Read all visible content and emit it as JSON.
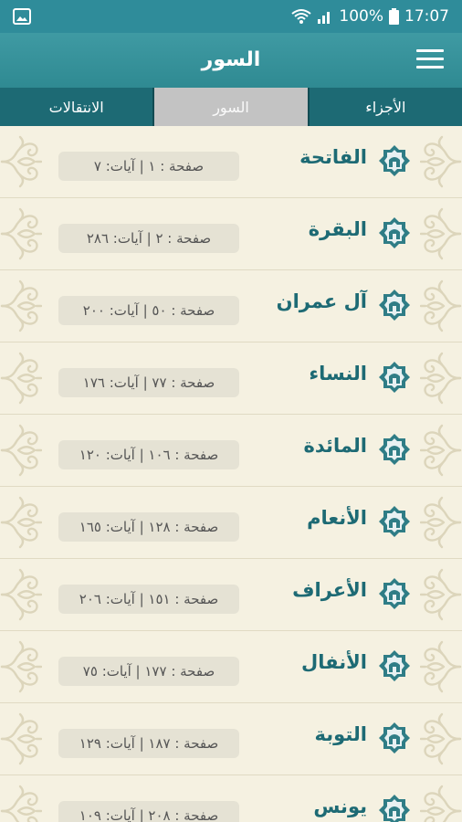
{
  "status_bar": {
    "battery": "100%",
    "time": "17:07"
  },
  "app_bar": {
    "title": "السور"
  },
  "tabs": [
    {
      "label": "الأجزاء",
      "selected": false
    },
    {
      "label": "السور",
      "selected": true
    },
    {
      "label": "الانتقالات",
      "selected": false
    }
  ],
  "suras": [
    {
      "name": "الفاتحة",
      "info": "صفحة : ١ | آيات: ٧"
    },
    {
      "name": "البقرة",
      "info": "صفحة : ٢ | آيات: ٢٨٦"
    },
    {
      "name": "آل عمران",
      "info": "صفحة : ٥٠ | آيات: ٢٠٠"
    },
    {
      "name": "النساء",
      "info": "صفحة : ٧٧ | آيات: ١٧٦"
    },
    {
      "name": "المائدة",
      "info": "صفحة : ١٠٦ | آيات: ١٢٠"
    },
    {
      "name": "الأنعام",
      "info": "صفحة : ١٢٨ | آيات: ١٦٥"
    },
    {
      "name": "الأعراف",
      "info": "صفحة : ١٥١ | آيات: ٢٠٦"
    },
    {
      "name": "الأنفال",
      "info": "صفحة : ١٧٧ | آيات: ٧٥"
    },
    {
      "name": "التوبة",
      "info": "صفحة : ١٨٧ | آيات: ١٢٩"
    },
    {
      "name": "يونس",
      "info": "صفحة : ٢٠٨ | آيات: ١٠٩"
    }
  ],
  "colors": {
    "primary": "#2f8c9a",
    "dark": "#1d6a74",
    "background": "#f5f1e1",
    "pill": "#e5e2d4"
  }
}
